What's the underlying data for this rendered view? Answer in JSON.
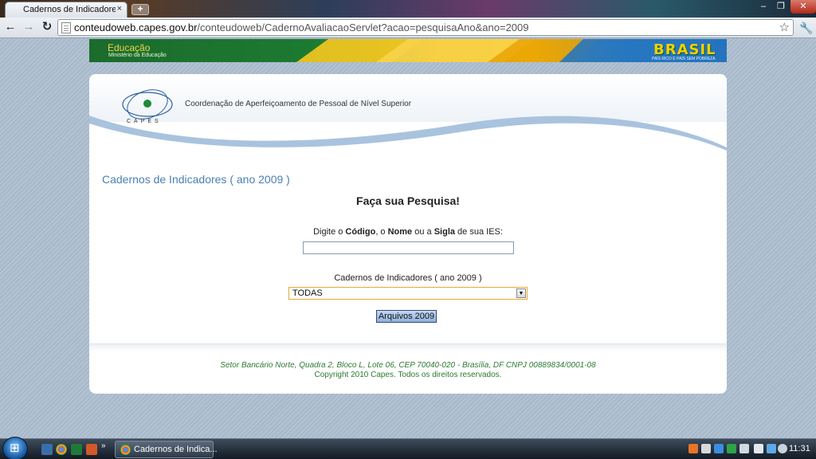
{
  "browser": {
    "tab_title": "Cadernos de Indicadores ( a",
    "tab_close": "×",
    "new_tab": "+",
    "url_host": "conteudoweb.capes.gov.br",
    "url_path": "/conteudoweb/CadernoAvaliacaoServlet?acao=pesquisaAno&ano=2009",
    "window_controls": {
      "minimize": "–",
      "maximize": "❐",
      "close": "✕"
    }
  },
  "gov_banner": {
    "title": "Educação",
    "subtitle": "Ministério da Educação",
    "brand": "BRASIL",
    "brand_tagline": "PAÍS RICO É PAÍS SEM POBREZA"
  },
  "header": {
    "logo_text": "CAPES",
    "org_name": "Coordenação de Aperfeiçoamento de Pessoal de Nível Superior"
  },
  "main": {
    "page_title": "Cadernos de Indicadores ( ano 2009 )",
    "search_heading": "Faça sua Pesquisa!",
    "search_label_parts": [
      "Digite o ",
      "Código",
      ", o ",
      "Nome",
      " ou a ",
      "Sigla",
      " de sua IES:"
    ],
    "search_value": "",
    "select_label": "Cadernos de Indicadores ( ano 2009 )",
    "select_value": "TODAS",
    "submit_label": "Arquivos 2009"
  },
  "footer": {
    "address": "Setor Bancário Norte, Quadra 2, Bloco L, Lote 06, CEP 70040-020 - Brasília, DF CNPJ 00889834/0001-08",
    "copyright": "Copyright 2010 Capes. Todos os direitos reservados."
  },
  "taskbar": {
    "ql_more": "»",
    "task_label": "Cadernos de Indica...",
    "clock": "11:31"
  },
  "colors": {
    "title_blue": "#4a7fb5",
    "footer_green": "#2d7a33",
    "select_border": "#e5a93a"
  }
}
